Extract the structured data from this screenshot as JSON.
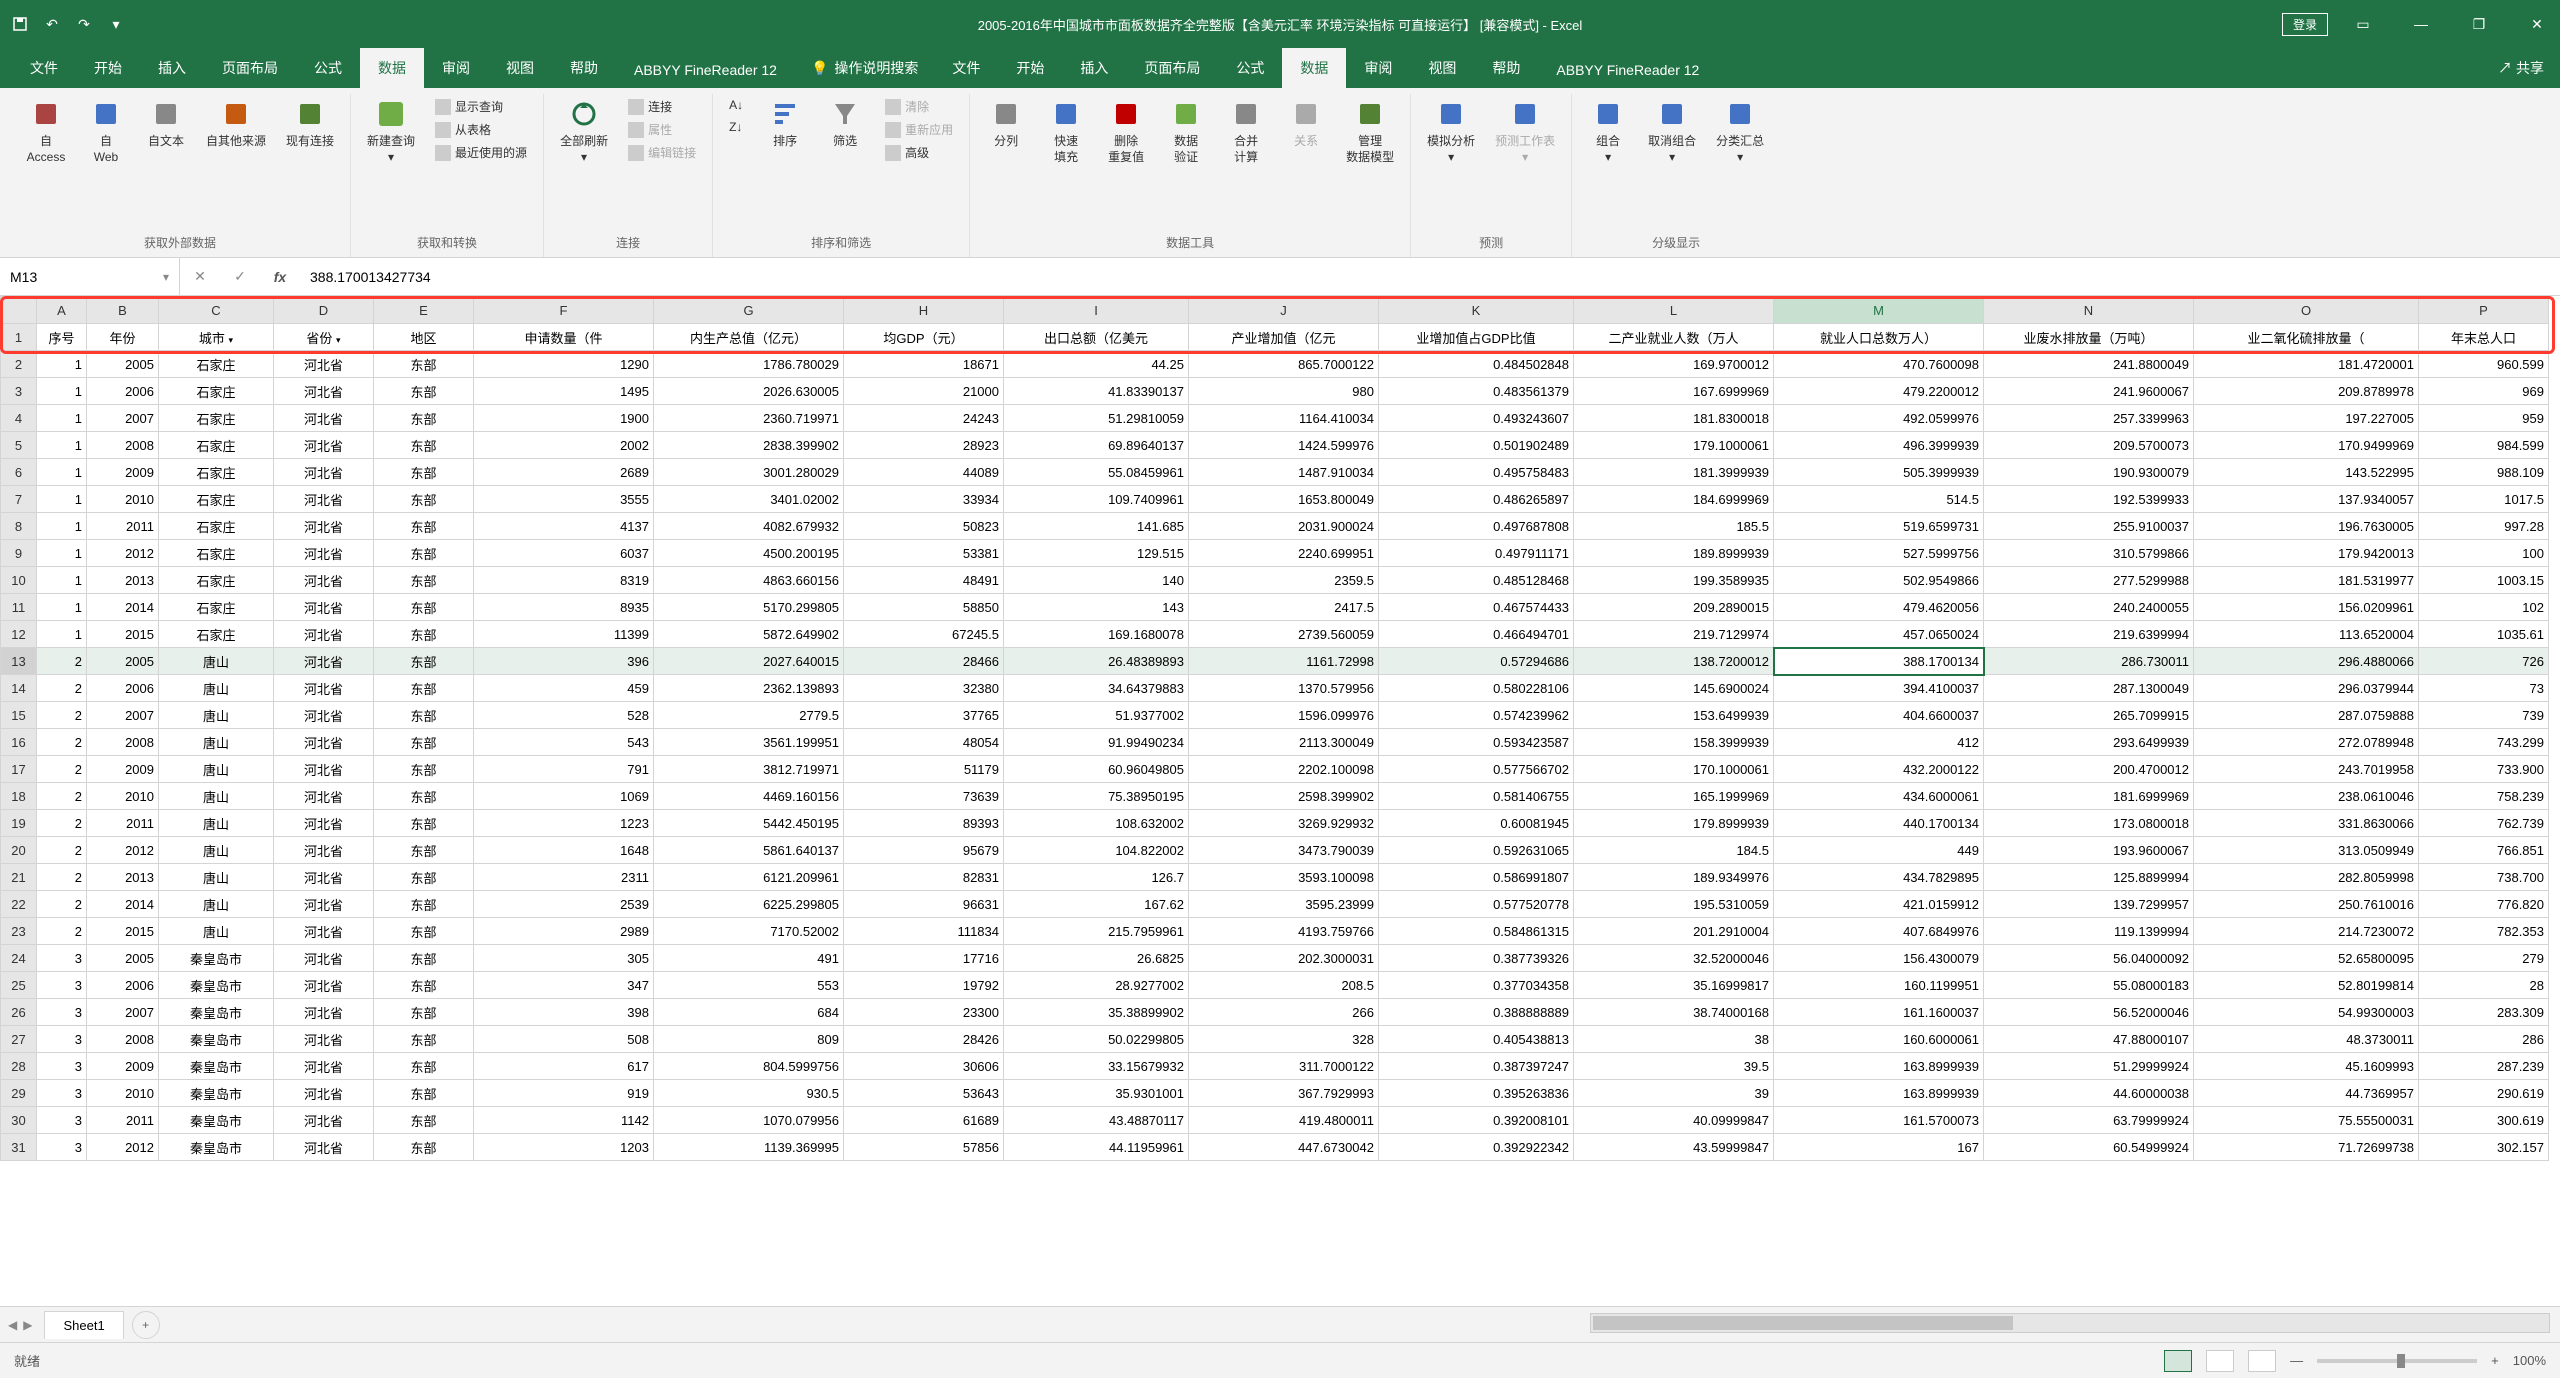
{
  "window": {
    "title": "2005-2016年中国城市市面板数据齐全完整版【含美元汇率 环境污染指标 可直接运行】 [兼容模式] - Excel",
    "login": "登录",
    "share": "共享"
  },
  "tabs": [
    "文件",
    "开始",
    "插入",
    "页面布局",
    "公式",
    "数据",
    "审阅",
    "视图",
    "帮助",
    "ABBYY FineReader 12"
  ],
  "active_tab": "数据",
  "tell_me": "操作说明搜索",
  "ribbon": {
    "g1": {
      "label": "获取外部数据",
      "items": [
        "自 Access",
        "自 Web",
        "自文本",
        "自其他来源",
        "现有连接"
      ]
    },
    "g2": {
      "label": "获取和转换",
      "main": "新建查询",
      "sub": [
        "显示查询",
        "从表格",
        "最近使用的源"
      ]
    },
    "g3": {
      "label": "连接",
      "main": "全部刷新",
      "sub": [
        "连接",
        "属性",
        "编辑链接"
      ]
    },
    "g4": {
      "label": "排序和筛选",
      "items": [
        "排序",
        "筛选"
      ],
      "small": [
        "A↓Z",
        "Z↓A"
      ],
      "sub": [
        "清除",
        "重新应用",
        "高级"
      ]
    },
    "g5": {
      "label": "数据工具",
      "items": [
        "分列",
        "快速填充",
        "删除重复值",
        "数据验证",
        "合并计算",
        "关系",
        "管理数据模型"
      ]
    },
    "g6": {
      "label": "预测",
      "items": [
        "模拟分析",
        "预测工作表"
      ]
    },
    "g7": {
      "label": "分级显示",
      "items": [
        "组合",
        "取消组合",
        "分类汇总"
      ]
    }
  },
  "namebox": "M13",
  "formula": "388.170013427734",
  "columns": [
    "A",
    "B",
    "C",
    "D",
    "E",
    "F",
    "G",
    "H",
    "I",
    "J",
    "K",
    "L",
    "M",
    "N",
    "O",
    "P"
  ],
  "headers": [
    "序号",
    "年份",
    "城市",
    "省份",
    "地区",
    "申请数量（件",
    "内生产总值（亿元）",
    "均GDP（元）",
    "出口总额（亿美元",
    "产业增加值（亿元",
    "业增加值占GDP比值",
    "二产业就业人数（万人",
    "就业人口总数万人）",
    "业废水排放量（万吨）",
    "业二氧化硫排放量（",
    "年末总人口"
  ],
  "selected_cell": {
    "row": 13,
    "col": "M"
  },
  "rows": [
    {
      "n": 2,
      "d": [
        "1",
        "2005",
        "石家庄",
        "河北省",
        "东部",
        "1290",
        "1786.780029",
        "18671",
        "44.25",
        "865.7000122",
        "0.484502848",
        "169.9700012",
        "470.7600098",
        "241.8800049",
        "181.4720001",
        "960.599"
      ]
    },
    {
      "n": 3,
      "d": [
        "1",
        "2006",
        "石家庄",
        "河北省",
        "东部",
        "1495",
        "2026.630005",
        "21000",
        "41.83390137",
        "980",
        "0.483561379",
        "167.6999969",
        "479.2200012",
        "241.9600067",
        "209.8789978",
        "969"
      ]
    },
    {
      "n": 4,
      "d": [
        "1",
        "2007",
        "石家庄",
        "河北省",
        "东部",
        "1900",
        "2360.719971",
        "24243",
        "51.29810059",
        "1164.410034",
        "0.493243607",
        "181.8300018",
        "492.0599976",
        "257.3399963",
        "197.227005",
        "959"
      ]
    },
    {
      "n": 5,
      "d": [
        "1",
        "2008",
        "石家庄",
        "河北省",
        "东部",
        "2002",
        "2838.399902",
        "28923",
        "69.89640137",
        "1424.599976",
        "0.501902489",
        "179.1000061",
        "496.3999939",
        "209.5700073",
        "170.9499969",
        "984.599"
      ]
    },
    {
      "n": 6,
      "d": [
        "1",
        "2009",
        "石家庄",
        "河北省",
        "东部",
        "2689",
        "3001.280029",
        "44089",
        "55.08459961",
        "1487.910034",
        "0.495758483",
        "181.3999939",
        "505.3999939",
        "190.9300079",
        "143.522995",
        "988.109"
      ]
    },
    {
      "n": 7,
      "d": [
        "1",
        "2010",
        "石家庄",
        "河北省",
        "东部",
        "3555",
        "3401.02002",
        "33934",
        "109.7409961",
        "1653.800049",
        "0.486265897",
        "184.6999969",
        "514.5",
        "192.5399933",
        "137.9340057",
        "1017.5"
      ]
    },
    {
      "n": 8,
      "d": [
        "1",
        "2011",
        "石家庄",
        "河北省",
        "东部",
        "4137",
        "4082.679932",
        "50823",
        "141.685",
        "2031.900024",
        "0.497687808",
        "185.5",
        "519.6599731",
        "255.9100037",
        "196.7630005",
        "997.28"
      ]
    },
    {
      "n": 9,
      "d": [
        "1",
        "2012",
        "石家庄",
        "河北省",
        "东部",
        "6037",
        "4500.200195",
        "53381",
        "129.515",
        "2240.699951",
        "0.497911171",
        "189.8999939",
        "527.5999756",
        "310.5799866",
        "179.9420013",
        "100"
      ]
    },
    {
      "n": 10,
      "d": [
        "1",
        "2013",
        "石家庄",
        "河北省",
        "东部",
        "8319",
        "4863.660156",
        "48491",
        "140",
        "2359.5",
        "0.485128468",
        "199.3589935",
        "502.9549866",
        "277.5299988",
        "181.5319977",
        "1003.15"
      ]
    },
    {
      "n": 11,
      "d": [
        "1",
        "2014",
        "石家庄",
        "河北省",
        "东部",
        "8935",
        "5170.299805",
        "58850",
        "143",
        "2417.5",
        "0.467574433",
        "209.2890015",
        "479.4620056",
        "240.2400055",
        "156.0209961",
        "102"
      ]
    },
    {
      "n": 12,
      "d": [
        "1",
        "2015",
        "石家庄",
        "河北省",
        "东部",
        "11399",
        "5872.649902",
        "67245.5",
        "169.1680078",
        "2739.560059",
        "0.466494701",
        "219.7129974",
        "457.0650024",
        "219.6399994",
        "113.6520004",
        "1035.61"
      ]
    },
    {
      "n": 13,
      "d": [
        "2",
        "2005",
        "唐山",
        "河北省",
        "东部",
        "396",
        "2027.640015",
        "28466",
        "26.48389893",
        "1161.72998",
        "0.57294686",
        "138.7200012",
        "388.1700134",
        "286.730011",
        "296.4880066",
        "726"
      ]
    },
    {
      "n": 14,
      "d": [
        "2",
        "2006",
        "唐山",
        "河北省",
        "东部",
        "459",
        "2362.139893",
        "32380",
        "34.64379883",
        "1370.579956",
        "0.580228106",
        "145.6900024",
        "394.4100037",
        "287.1300049",
        "296.0379944",
        "73"
      ]
    },
    {
      "n": 15,
      "d": [
        "2",
        "2007",
        "唐山",
        "河北省",
        "东部",
        "528",
        "2779.5",
        "37765",
        "51.9377002",
        "1596.099976",
        "0.574239962",
        "153.6499939",
        "404.6600037",
        "265.7099915",
        "287.0759888",
        "739"
      ]
    },
    {
      "n": 16,
      "d": [
        "2",
        "2008",
        "唐山",
        "河北省",
        "东部",
        "543",
        "3561.199951",
        "48054",
        "91.99490234",
        "2113.300049",
        "0.593423587",
        "158.3999939",
        "412",
        "293.6499939",
        "272.0789948",
        "743.299"
      ]
    },
    {
      "n": 17,
      "d": [
        "2",
        "2009",
        "唐山",
        "河北省",
        "东部",
        "791",
        "3812.719971",
        "51179",
        "60.96049805",
        "2202.100098",
        "0.577566702",
        "170.1000061",
        "432.2000122",
        "200.4700012",
        "243.7019958",
        "733.900"
      ]
    },
    {
      "n": 18,
      "d": [
        "2",
        "2010",
        "唐山",
        "河北省",
        "东部",
        "1069",
        "4469.160156",
        "73639",
        "75.38950195",
        "2598.399902",
        "0.581406755",
        "165.1999969",
        "434.6000061",
        "181.6999969",
        "238.0610046",
        "758.239"
      ]
    },
    {
      "n": 19,
      "d": [
        "2",
        "2011",
        "唐山",
        "河北省",
        "东部",
        "1223",
        "5442.450195",
        "89393",
        "108.632002",
        "3269.929932",
        "0.60081945",
        "179.8999939",
        "440.1700134",
        "173.0800018",
        "331.8630066",
        "762.739"
      ]
    },
    {
      "n": 20,
      "d": [
        "2",
        "2012",
        "唐山",
        "河北省",
        "东部",
        "1648",
        "5861.640137",
        "95679",
        "104.822002",
        "3473.790039",
        "0.592631065",
        "184.5",
        "449",
        "193.9600067",
        "313.0509949",
        "766.851"
      ]
    },
    {
      "n": 21,
      "d": [
        "2",
        "2013",
        "唐山",
        "河北省",
        "东部",
        "2311",
        "6121.209961",
        "82831",
        "126.7",
        "3593.100098",
        "0.586991807",
        "189.9349976",
        "434.7829895",
        "125.8899994",
        "282.8059998",
        "738.700"
      ]
    },
    {
      "n": 22,
      "d": [
        "2",
        "2014",
        "唐山",
        "河北省",
        "东部",
        "2539",
        "6225.299805",
        "96631",
        "167.62",
        "3595.23999",
        "0.577520778",
        "195.5310059",
        "421.0159912",
        "139.7299957",
        "250.7610016",
        "776.820"
      ]
    },
    {
      "n": 23,
      "d": [
        "2",
        "2015",
        "唐山",
        "河北省",
        "东部",
        "2989",
        "7170.52002",
        "111834",
        "215.7959961",
        "4193.759766",
        "0.584861315",
        "201.2910004",
        "407.6849976",
        "119.1399994",
        "214.7230072",
        "782.353"
      ]
    },
    {
      "n": 24,
      "d": [
        "3",
        "2005",
        "秦皇岛市",
        "河北省",
        "东部",
        "305",
        "491",
        "17716",
        "26.6825",
        "202.3000031",
        "0.387739326",
        "32.52000046",
        "156.4300079",
        "56.04000092",
        "52.65800095",
        "279"
      ]
    },
    {
      "n": 25,
      "d": [
        "3",
        "2006",
        "秦皇岛市",
        "河北省",
        "东部",
        "347",
        "553",
        "19792",
        "28.9277002",
        "208.5",
        "0.377034358",
        "35.16999817",
        "160.1199951",
        "55.08000183",
        "52.80199814",
        "28"
      ]
    },
    {
      "n": 26,
      "d": [
        "3",
        "2007",
        "秦皇岛市",
        "河北省",
        "东部",
        "398",
        "684",
        "23300",
        "35.38899902",
        "266",
        "0.388888889",
        "38.74000168",
        "161.1600037",
        "56.52000046",
        "54.99300003",
        "283.309"
      ]
    },
    {
      "n": 27,
      "d": [
        "3",
        "2008",
        "秦皇岛市",
        "河北省",
        "东部",
        "508",
        "809",
        "28426",
        "50.02299805",
        "328",
        "0.405438813",
        "38",
        "160.6000061",
        "47.88000107",
        "48.3730011",
        "286"
      ]
    },
    {
      "n": 28,
      "d": [
        "3",
        "2009",
        "秦皇岛市",
        "河北省",
        "东部",
        "617",
        "804.5999756",
        "30606",
        "33.15679932",
        "311.7000122",
        "0.387397247",
        "39.5",
        "163.8999939",
        "51.29999924",
        "45.1609993",
        "287.239"
      ]
    },
    {
      "n": 29,
      "d": [
        "3",
        "2010",
        "秦皇岛市",
        "河北省",
        "东部",
        "919",
        "930.5",
        "53643",
        "35.9301001",
        "367.7929993",
        "0.395263836",
        "39",
        "163.8999939",
        "44.60000038",
        "44.7369957",
        "290.619"
      ]
    },
    {
      "n": 30,
      "d": [
        "3",
        "2011",
        "秦皇岛市",
        "河北省",
        "东部",
        "1142",
        "1070.079956",
        "61689",
        "43.48870117",
        "419.4800011",
        "0.392008101",
        "40.09999847",
        "161.5700073",
        "63.79999924",
        "75.55500031",
        "300.619"
      ]
    },
    {
      "n": 31,
      "d": [
        "3",
        "2012",
        "秦皇岛市",
        "河北省",
        "东部",
        "1203",
        "1139.369995",
        "57856",
        "44.11959961",
        "447.6730042",
        "0.392922342",
        "43.59999847",
        "167",
        "60.54999924",
        "71.72699738",
        "302.157"
      ]
    }
  ],
  "sheet": {
    "name": "Sheet1"
  },
  "status": {
    "ready": "就绪",
    "zoom": "100%"
  }
}
